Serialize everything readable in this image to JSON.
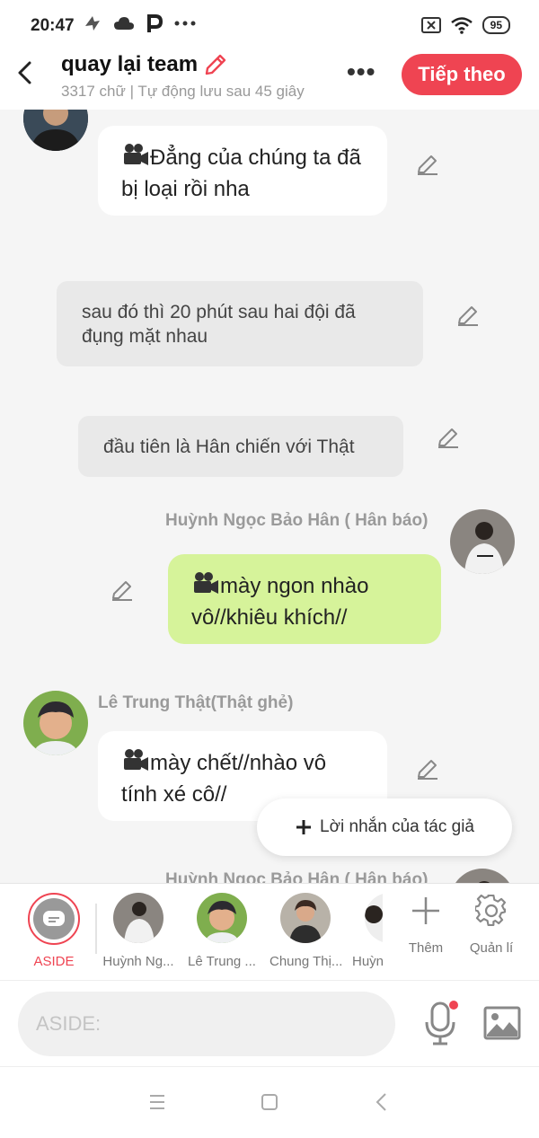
{
  "status_bar": {
    "time": "20:47",
    "icons": [
      "notification-icon",
      "cloud-icon",
      "p-icon",
      "more-dots-icon"
    ],
    "right_icons": [
      "sim-x-icon",
      "wifi-icon"
    ],
    "battery": "95"
  },
  "header": {
    "title": "quay lại team",
    "subtitle": "3317 chữ | Tự động lưu sau 45 giây",
    "next_label": "Tiếp theo"
  },
  "messages": [
    {
      "kind": "speech",
      "side": "left",
      "text": "Đẳng của chúng ta đã bị loại rồi nha"
    },
    {
      "kind": "narration",
      "text": "sau đó thì 20 phút sau hai đội đã đụng mặt nhau"
    },
    {
      "kind": "narration",
      "text": "đầu tiên là Hân chiến với Thật"
    },
    {
      "kind": "speech",
      "side": "right",
      "speaker": "Huỳnh Ngọc Bảo Hân ( Hân báo)",
      "text": "mày ngon nhào vô//khiêu khích//"
    },
    {
      "kind": "speech",
      "side": "left",
      "speaker": "Lê Trung Thật(Thật ghẻ)",
      "text": "mày chết//nhào vô tính xé cô//"
    },
    {
      "kind": "speech",
      "side": "right",
      "speaker": "Huỳnh Ngọc Bảo Hân ( Hân báo)"
    }
  ],
  "author_note_label": "Lời nhắn của tác giả",
  "characters": [
    {
      "label": "ASIDE"
    },
    {
      "label": "Huỳnh Ng..."
    },
    {
      "label": "Lê Trung ..."
    },
    {
      "label": "Chung Thị..."
    },
    {
      "label": "Huỳn"
    }
  ],
  "tools": {
    "add_label": "Thêm",
    "manage_label": "Quản lí"
  },
  "input": {
    "placeholder": "ASIDE:"
  },
  "colors": {
    "accent": "#ef4452",
    "green_bubble": "#d6f39a",
    "narration_bg": "#e9e9e9"
  }
}
